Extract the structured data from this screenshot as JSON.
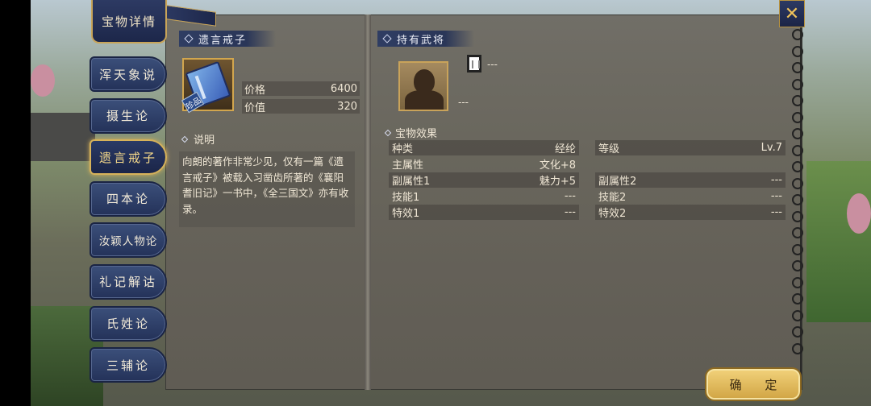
{
  "window": {
    "title": "宝物详情"
  },
  "tabs": [
    "浑天象说",
    "摄生论",
    "遗言戒子",
    "四本论",
    "汝颖人物论",
    "礼记解诂",
    "氏姓论",
    "三辅论"
  ],
  "active_tab_index": 2,
  "item": {
    "name": "遗言戒子",
    "rank_badge": "珍品",
    "price_label": "价格",
    "price_value": "6400",
    "worth_label": "价值",
    "worth_value": "320",
    "note_label": "说明",
    "description": "向朗的著作非常少见，仅有一篇《遗言戒子》被载入习凿齿所著的《襄阳耆旧记》一书中，《全三国文》亦有收录。"
  },
  "holder": {
    "section_title": "持有武将",
    "name_placeholder": "---",
    "sub_placeholder": "---"
  },
  "effects": {
    "section_title": "宝物效果",
    "rows": [
      {
        "l_label": "种类",
        "l_value": "经纶",
        "r_label": "等级",
        "r_value": "Lv.7"
      },
      {
        "l_label": "主属性",
        "l_value": "文化+8",
        "r_label": "",
        "r_value": ""
      },
      {
        "l_label": "副属性1",
        "l_value": "魅力+5",
        "r_label": "副属性2",
        "r_value": "---"
      },
      {
        "l_label": "技能1",
        "l_value": "---",
        "r_label": "技能2",
        "r_value": "---"
      },
      {
        "l_label": "特效1",
        "l_value": "---",
        "r_label": "特效2",
        "r_value": "---"
      }
    ]
  },
  "buttons": {
    "confirm": "确 定",
    "close_icon": "close-icon"
  },
  "colors": {
    "panel": "#66625a",
    "tab": "#2d3a63",
    "accent_gold": "#d7b25a",
    "confirm": "#e4bd5c"
  }
}
